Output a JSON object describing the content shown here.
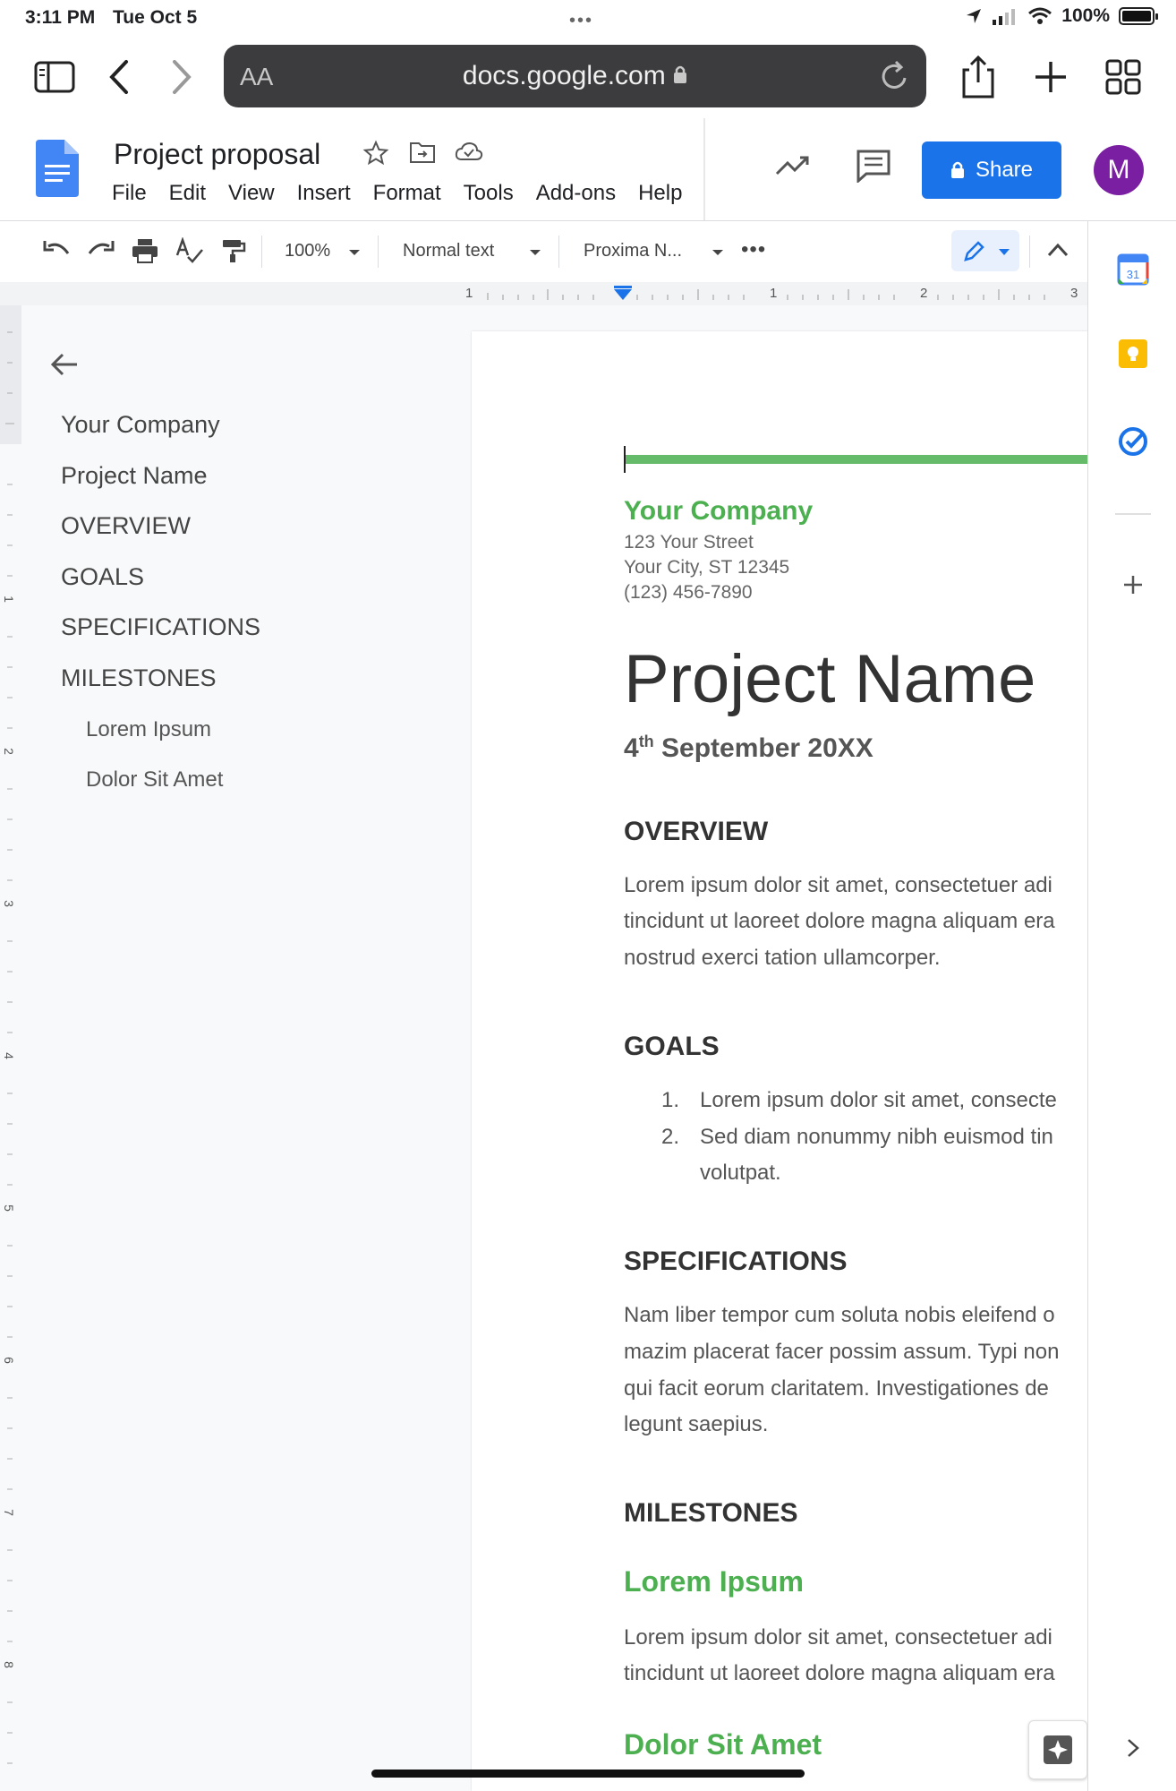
{
  "status": {
    "time": "3:11 PM",
    "date": "Tue Oct 5",
    "battery": "100%"
  },
  "browser": {
    "aa": "AA",
    "url": "docs.google.com"
  },
  "docs": {
    "title": "Project proposal",
    "menu": [
      "File",
      "Edit",
      "View",
      "Insert",
      "Format",
      "Tools",
      "Add-ons",
      "Help"
    ],
    "share_label": "Share",
    "avatar_initial": "M",
    "brand_color": "#1a73e8"
  },
  "toolbar": {
    "zoom": "100%",
    "style": "Normal text",
    "font": "Proxima N..."
  },
  "ruler": [
    "1",
    "1",
    "2",
    "3"
  ],
  "vruler": [
    "1",
    "2",
    "3",
    "4",
    "5",
    "6",
    "7",
    "8"
  ],
  "outline": {
    "items": [
      "Your Company",
      "Project Name",
      "OVERVIEW",
      "GOALS",
      "SPECIFICATIONS",
      "MILESTONES"
    ],
    "subitems": [
      "Lorem Ipsum",
      "Dolor Sit Amet"
    ]
  },
  "document": {
    "accent_color": "#4caf50",
    "company": "Your Company",
    "address": [
      "123 Your Street",
      "Your City, ST 12345",
      "(123) 456-7890"
    ],
    "project_name": "Project Name",
    "date_day": "4",
    "date_suffix": "th",
    "date_rest": " September 20XX",
    "overview_heading": "OVERVIEW",
    "overview_lines": [
      "Lorem ipsum dolor sit amet, consectetuer adi",
      "tincidunt ut laoreet dolore magna aliquam era",
      "nostrud exerci tation ullamcorper."
    ],
    "goals_heading": "GOALS",
    "goals": [
      {
        "num": "1.",
        "lines": [
          "Lorem ipsum dolor sit amet, consecte"
        ]
      },
      {
        "num": "2.",
        "lines": [
          "Sed diam nonummy nibh euismod tin",
          "volutpat."
        ]
      }
    ],
    "specs_heading": "SPECIFICATIONS",
    "specs_lines": [
      "Nam liber tempor cum soluta nobis eleifend o",
      "mazim placerat facer possim assum. Typi non",
      "qui facit eorum claritatem. Investigationes de",
      "legunt saepius."
    ],
    "milestones_heading": "MILESTONES",
    "milestone1_heading": "Lorem Ipsum",
    "milestone1_lines": [
      "Lorem ipsum dolor sit amet, consectetuer adi",
      "tincidunt ut laoreet dolore magna aliquam era"
    ],
    "milestone2_heading": "Dolor Sit Amet"
  }
}
